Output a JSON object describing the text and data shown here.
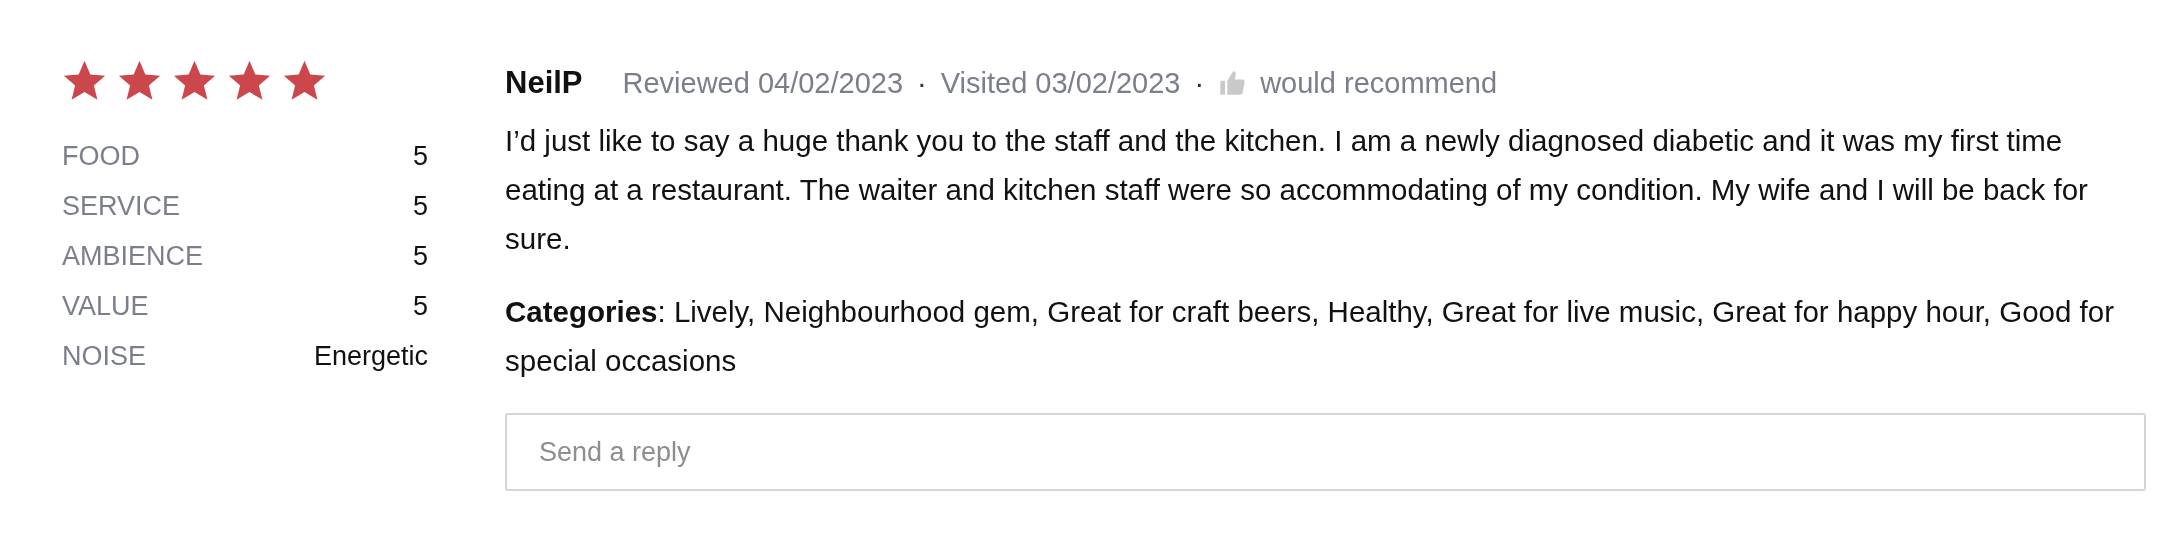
{
  "rating": {
    "stars": 5
  },
  "scores": [
    {
      "label": "FOOD",
      "value": "5"
    },
    {
      "label": "SERVICE",
      "value": "5"
    },
    {
      "label": "AMBIENCE",
      "value": "5"
    },
    {
      "label": "VALUE",
      "value": "5"
    },
    {
      "label": "NOISE",
      "value": "Energetic"
    }
  ],
  "review": {
    "author": "NeilP",
    "reviewed": "Reviewed 04/02/2023",
    "separator_1": "·",
    "visited": "Visited 03/02/2023",
    "separator_2": "·",
    "recommend": "would recommend",
    "body": "I’d just like to say a huge thank you to the staff and the kitchen. I am a newly diagnosed diabetic and it was my first time eating at a restaurant. The waiter and kitchen staff were so accommodating of my condition. My wife and I will be back for sure.",
    "categories": "**Categories**: Lively, Neighbourhood gem, Great for craft beers, Healthy, Great for live music, Great for happy hour, Good for special occasions"
  },
  "reply": {
    "placeholder": "Send a reply"
  }
}
